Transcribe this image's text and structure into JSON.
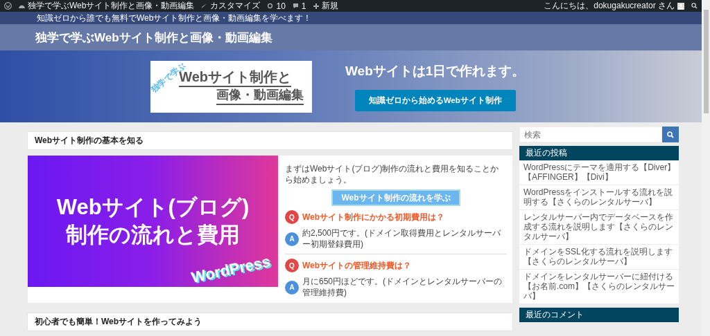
{
  "admin_bar": {
    "site_name": "独学で学ぶWebサイト制作と画像・動画編集",
    "customize": "カスタマイズ",
    "updates": "10",
    "comments": "1",
    "new": "新規",
    "greeting": "こんにちは、dokugakucreator さん"
  },
  "tagline": "知識ゼロから誰でも無料でWebサイト制作と画像・動画編集を学べます！",
  "site_title": "独学で学ぶWebサイト制作と画像・動画編集",
  "hero": {
    "logo": {
      "small": "独学で学ぶ",
      "line_1": "Webサイト制作と",
      "line_2": "画像・動画編集"
    },
    "heading": "Webサイトは1日で作れます。",
    "button": "知識ゼロから始めるWebサイト制作"
  },
  "sections": [
    {
      "title": "Webサイト制作の基本を知る",
      "eyecatch": {
        "line_1": "Webサイト(ブログ)",
        "line_2": "制作の流れと費用",
        "tag": "WordPress"
      },
      "intro": "まずはWebサイト(ブログ)制作の流れと費用を知ることから始めましょう。",
      "button": "Webサイト制作の流れを学ぶ",
      "faq": [
        {
          "q_mark": "Q",
          "question": "Webサイト制作にかかる初期費用は？",
          "a_mark": "A",
          "answer": "約2,500円です。(ドメイン取得費用とレンタルサーバー初期登録費用)"
        },
        {
          "q_mark": "Q",
          "question": "Webサイトの管理維持費は？",
          "a_mark": "A",
          "answer": "月に650円ほどです。(ドメインとレンタルサーバーの管理維持費)"
        }
      ]
    },
    {
      "title": "初心者でも簡単！Webサイトを作ってみよう"
    }
  ],
  "sidebar": {
    "search": {
      "placeholder": "検索"
    },
    "widgets": [
      {
        "title": "最近の投稿",
        "items": [
          "WordPressにテーマを適用する【Diver】【AFFINGER】【Divi】",
          "WordPressをインストールする流れを説明する【さくらのレンタルサーバ】",
          "レンタルサーバー内でデータベースを作成する流れを説明します【さくらのレンタルサーバ】",
          "ドメインをSSL化する流れを説明します【さくらのレンタルサーバ】",
          "ドメインをレンタルサーバーに紐付ける【お名前.com】【さくらのレンタルサーバ】"
        ]
      },
      {
        "title": "最近のコメント"
      }
    ]
  }
}
